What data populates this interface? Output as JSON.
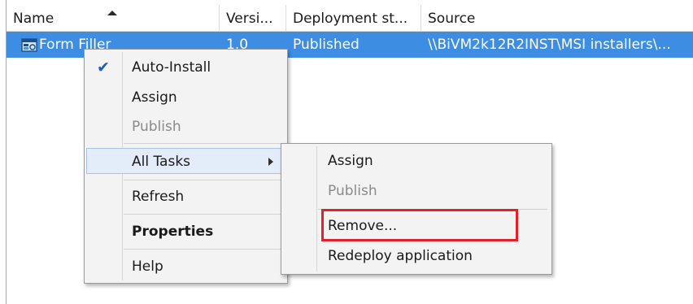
{
  "columns": {
    "name": "Name",
    "version": "Versi...",
    "deployment": "Deployment st...",
    "source": "Source"
  },
  "row": {
    "name": "Form Filler",
    "version": "1.0",
    "deployment": "Published",
    "source": "\\\\BiVM2k12R2INST\\MSI installers\\..."
  },
  "context_menu": {
    "auto_install": "Auto-Install",
    "auto_install_checked": true,
    "assign": "Assign",
    "publish": "Publish",
    "all_tasks": "All Tasks",
    "refresh": "Refresh",
    "properties": "Properties",
    "help": "Help"
  },
  "all_tasks_submenu": {
    "assign": "Assign",
    "publish": "Publish",
    "remove": "Remove...",
    "redeploy": "Redeploy application"
  },
  "colors": {
    "selection": "#3d8ee3",
    "highlight_box": "#e0202a",
    "menu_background": "#f3f3f3"
  },
  "icons": {
    "app_icon": "application-package-icon",
    "check": "checkmark-icon",
    "arrow": "submenu-arrow-icon",
    "sort": "sort-ascending-icon"
  }
}
